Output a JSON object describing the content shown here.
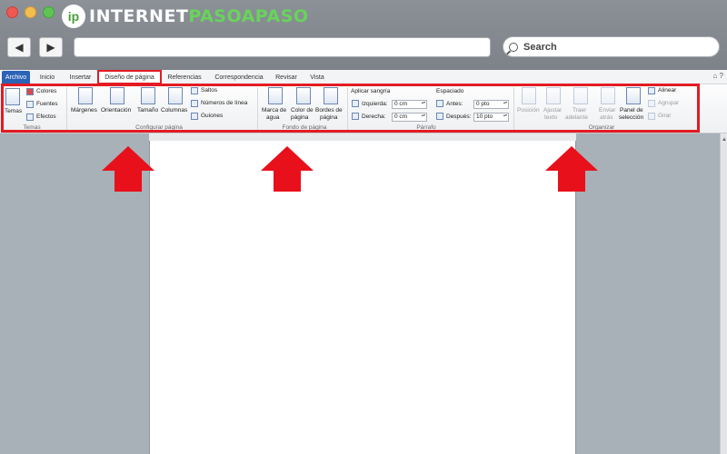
{
  "brand": {
    "prefix": "INTERNET",
    "highlight": "PASOAPASO",
    "logo_letter": "ip"
  },
  "browser": {
    "search_label": "Search",
    "back_icon": "◀",
    "forward_icon": "▶"
  },
  "ribbon_tabs": [
    "Archivo",
    "Inicio",
    "Insertar",
    "Diseño de página",
    "Referencias",
    "Correspondencia",
    "Revisar",
    "Vista"
  ],
  "active_tab": "Diseño de página",
  "groups": {
    "temas": {
      "label": "Temas",
      "temas_button": "Temas",
      "colores": "Colores",
      "fuentes": "Fuentes",
      "efectos": "Efectos"
    },
    "configurar_pagina": {
      "label": "Configurar página",
      "margenes": "Márgenes",
      "orientacion": "Orientación",
      "tamano": "Tamaño",
      "columnas": "Columnas",
      "saltos": "Saltos",
      "numeros_linea": "Números de línea",
      "guiones": "Guiones"
    },
    "fondo_pagina": {
      "label": "Fondo de página",
      "marca_agua_1": "Marca de",
      "marca_agua_2": "agua",
      "color_pagina_1": "Color de",
      "color_pagina_2": "página",
      "bordes_pagina_1": "Bordes de",
      "bordes_pagina_2": "página"
    },
    "parrafo": {
      "label": "Párrafo",
      "aplicar_sangria": "Aplicar sangría",
      "izquierda_label": "Izquierda:",
      "izquierda_value": "0 cm",
      "derecha_label": "Derecha:",
      "derecha_value": "0 cm",
      "espaciado": "Espaciado",
      "antes_label": "Antes:",
      "antes_value": "0 pto",
      "despues_label": "Después:",
      "despues_value": "10 pto"
    },
    "organizar": {
      "label": "Organizar",
      "posicion": "Posición",
      "ajustar_1": "Ajustar",
      "ajustar_2": "texto",
      "traer_1": "Traer",
      "traer_2": "adelante",
      "enviar_1": "Enviar",
      "enviar_2": "atrás",
      "panel_1": "Panel de",
      "panel_2": "selección",
      "alinear": "Alinear",
      "agrupar": "Agrupar",
      "girar": "Girar"
    }
  },
  "colors": {
    "highlight": "#e31b23",
    "file_tab": "#2b63b7",
    "brand_green": "#67d45a"
  }
}
